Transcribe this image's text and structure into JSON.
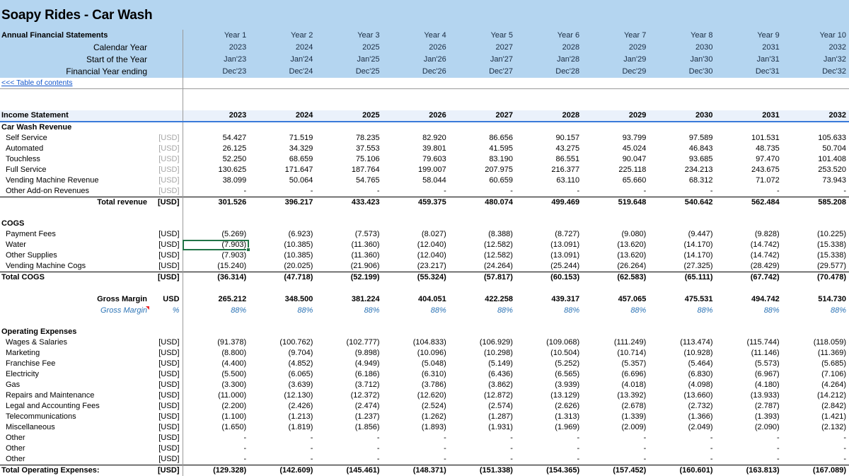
{
  "app": {
    "title": "Soapy Rides - Car Wash",
    "subtitle": "Annual Financial Statements",
    "toc_link": "<<< Table of contents",
    "selected_cell": {
      "row": "Water",
      "column": "2023",
      "value": "(7.903)"
    },
    "accent_color": "#3a7ad9",
    "banner_color": "#b4d5f0",
    "selection_color": "#217346",
    "blue_text_color": "#2e75b6"
  },
  "header": {
    "row_labels": [
      "Calendar Year",
      "Start of the Year",
      "Financial Year ending"
    ],
    "years": [
      "Year 1",
      "Year 2",
      "Year 3",
      "Year 4",
      "Year 5",
      "Year 6",
      "Year 7",
      "Year 8",
      "Year 9",
      "Year 10"
    ],
    "calendar_year": [
      "2023",
      "2024",
      "2025",
      "2026",
      "2027",
      "2028",
      "2029",
      "2030",
      "2031",
      "2032"
    ],
    "start_of_year": [
      "Jan'23",
      "Jan'24",
      "Jan'25",
      "Jan'26",
      "Jan'27",
      "Jan'28",
      "Jan'29",
      "Jan'30",
      "Jan'31",
      "Jan'32"
    ],
    "financial_year_ending": [
      "Dec'23",
      "Dec'24",
      "Dec'25",
      "Dec'26",
      "Dec'27",
      "Dec'28",
      "Dec'29",
      "Dec'30",
      "Dec'31",
      "Dec'32"
    ]
  },
  "statement": {
    "title": "Income Statement",
    "columns": [
      "2023",
      "2024",
      "2025",
      "2026",
      "2027",
      "2028",
      "2029",
      "2030",
      "2031",
      "2032"
    ],
    "unit": "[USD]",
    "unit_bracket": "[USD]",
    "usd_text": "USD",
    "pct_text": "%"
  },
  "revenue": {
    "section": "Car Wash Revenue",
    "rows": [
      {
        "label": "Self Service",
        "unit": "[USD]",
        "values": [
          "54.427",
          "71.519",
          "78.235",
          "82.920",
          "86.656",
          "90.157",
          "93.799",
          "97.589",
          "101.531",
          "105.633"
        ]
      },
      {
        "label": "Automated",
        "unit": "[USD]",
        "values": [
          "26.125",
          "34.329",
          "37.553",
          "39.801",
          "41.595",
          "43.275",
          "45.024",
          "46.843",
          "48.735",
          "50.704"
        ]
      },
      {
        "label": "Touchless",
        "unit": "[USD]",
        "values": [
          "52.250",
          "68.659",
          "75.106",
          "79.603",
          "83.190",
          "86.551",
          "90.047",
          "93.685",
          "97.470",
          "101.408"
        ]
      },
      {
        "label": "Full Service",
        "unit": "[USD]",
        "values": [
          "130.625",
          "171.647",
          "187.764",
          "199.007",
          "207.975",
          "216.377",
          "225.118",
          "234.213",
          "243.675",
          "253.520"
        ]
      },
      {
        "label": "Vending Machine Revenue",
        "unit": "[USD]",
        "values": [
          "38.099",
          "50.064",
          "54.765",
          "58.044",
          "60.659",
          "63.110",
          "65.660",
          "68.312",
          "71.072",
          "73.943"
        ]
      },
      {
        "label": "Other Add-on Revenues",
        "unit": "[USD]",
        "values": [
          "-",
          "-",
          "-",
          "-",
          "-",
          "-",
          "-",
          "-",
          "-",
          "-"
        ]
      }
    ],
    "total": {
      "label": "Total revenue",
      "unit": "[USD]",
      "values": [
        "301.526",
        "396.217",
        "433.423",
        "459.375",
        "480.074",
        "499.469",
        "519.648",
        "540.642",
        "562.484",
        "585.208"
      ]
    }
  },
  "cogs": {
    "section": "COGS",
    "rows": [
      {
        "label": "Payment Fees",
        "unit": "[USD]",
        "values": [
          "(5.269)",
          "(6.923)",
          "(7.573)",
          "(8.027)",
          "(8.388)",
          "(8.727)",
          "(9.080)",
          "(9.447)",
          "(9.828)",
          "(10.225)"
        ]
      },
      {
        "label": "Water",
        "unit": "[USD]",
        "values": [
          "(7.903)",
          "(10.385)",
          "(11.360)",
          "(12.040)",
          "(12.582)",
          "(13.091)",
          "(13.620)",
          "(14.170)",
          "(14.742)",
          "(15.338)"
        ]
      },
      {
        "label": "Other Supplies",
        "unit": "[USD]",
        "values": [
          "(7.903)",
          "(10.385)",
          "(11.360)",
          "(12.040)",
          "(12.582)",
          "(13.091)",
          "(13.620)",
          "(14.170)",
          "(14.742)",
          "(15.338)"
        ]
      },
      {
        "label": "Vending Machine Cogs",
        "unit": "[USD]",
        "values": [
          "(15.240)",
          "(20.025)",
          "(21.906)",
          "(23.217)",
          "(24.264)",
          "(25.244)",
          "(26.264)",
          "(27.325)",
          "(28.429)",
          "(29.577)"
        ]
      }
    ],
    "total": {
      "label": "Total COGS",
      "unit": "[USD]",
      "values": [
        "(36.314)",
        "(47.718)",
        "(52.199)",
        "(55.324)",
        "(57.817)",
        "(60.153)",
        "(62.583)",
        "(65.111)",
        "(67.742)",
        "(70.478)"
      ]
    }
  },
  "gross_margin": {
    "label_usd": "Gross Margin",
    "unit_usd": "USD",
    "values_usd": [
      "265.212",
      "348.500",
      "381.224",
      "404.051",
      "422.258",
      "439.317",
      "457.065",
      "475.531",
      "494.742",
      "514.730"
    ],
    "label_pct": "Gross Margin",
    "unit_pct": "%",
    "values_pct": [
      "88%",
      "88%",
      "88%",
      "88%",
      "88%",
      "88%",
      "88%",
      "88%",
      "88%",
      "88%"
    ]
  },
  "opex": {
    "section": "Operating Expenses",
    "rows": [
      {
        "label": "Wages & Salaries",
        "unit": "[USD]",
        "values": [
          "(91.378)",
          "(100.762)",
          "(102.777)",
          "(104.833)",
          "(106.929)",
          "(109.068)",
          "(111.249)",
          "(113.474)",
          "(115.744)",
          "(118.059)"
        ]
      },
      {
        "label": "Marketing",
        "unit": "[USD]",
        "values": [
          "(8.800)",
          "(9.704)",
          "(9.898)",
          "(10.096)",
          "(10.298)",
          "(10.504)",
          "(10.714)",
          "(10.928)",
          "(11.146)",
          "(11.369)"
        ]
      },
      {
        "label": "Franchise Fee",
        "unit": "[USD]",
        "values": [
          "(4.400)",
          "(4.852)",
          "(4.949)",
          "(5.048)",
          "(5.149)",
          "(5.252)",
          "(5.357)",
          "(5.464)",
          "(5.573)",
          "(5.685)"
        ]
      },
      {
        "label": "Electricity",
        "unit": "[USD]",
        "values": [
          "(5.500)",
          "(6.065)",
          "(6.186)",
          "(6.310)",
          "(6.436)",
          "(6.565)",
          "(6.696)",
          "(6.830)",
          "(6.967)",
          "(7.106)"
        ]
      },
      {
        "label": "Gas",
        "unit": "[USD]",
        "values": [
          "(3.300)",
          "(3.639)",
          "(3.712)",
          "(3.786)",
          "(3.862)",
          "(3.939)",
          "(4.018)",
          "(4.098)",
          "(4.180)",
          "(4.264)"
        ]
      },
      {
        "label": "Repairs and Maintenance",
        "unit": "[USD]",
        "values": [
          "(11.000)",
          "(12.130)",
          "(12.372)",
          "(12.620)",
          "(12.872)",
          "(13.129)",
          "(13.392)",
          "(13.660)",
          "(13.933)",
          "(14.212)"
        ]
      },
      {
        "label": "Legal and Accounting Fees",
        "unit": "[USD]",
        "values": [
          "(2.200)",
          "(2.426)",
          "(2.474)",
          "(2.524)",
          "(2.574)",
          "(2.626)",
          "(2.678)",
          "(2.732)",
          "(2.787)",
          "(2.842)"
        ]
      },
      {
        "label": "Telecommunications",
        "unit": "[USD]",
        "values": [
          "(1.100)",
          "(1.213)",
          "(1.237)",
          "(1.262)",
          "(1.287)",
          "(1.313)",
          "(1.339)",
          "(1.366)",
          "(1.393)",
          "(1.421)"
        ]
      },
      {
        "label": "Miscellaneous",
        "unit": "[USD]",
        "values": [
          "(1.650)",
          "(1.819)",
          "(1.856)",
          "(1.893)",
          "(1.931)",
          "(1.969)",
          "(2.009)",
          "(2.049)",
          "(2.090)",
          "(2.132)"
        ]
      },
      {
        "label": "Other",
        "unit": "[USD]",
        "values": [
          "-",
          "-",
          "-",
          "-",
          "-",
          "-",
          "-",
          "-",
          "-",
          "-"
        ]
      },
      {
        "label": "Other",
        "unit": "[USD]",
        "values": [
          "-",
          "-",
          "-",
          "-",
          "-",
          "-",
          "-",
          "-",
          "-",
          "-"
        ]
      },
      {
        "label": "Other",
        "unit": "[USD]",
        "values": [
          "-",
          "-",
          "-",
          "-",
          "-",
          "-",
          "-",
          "-",
          "-",
          "-"
        ]
      }
    ],
    "total": {
      "label": "Total Operating Expenses:",
      "unit": "[USD]",
      "values": [
        "(129.328)",
        "(142.609)",
        "(145.461)",
        "(148.371)",
        "(151.338)",
        "(154.365)",
        "(157.452)",
        "(160.601)",
        "(163.813)",
        "(167.089)"
      ]
    }
  }
}
